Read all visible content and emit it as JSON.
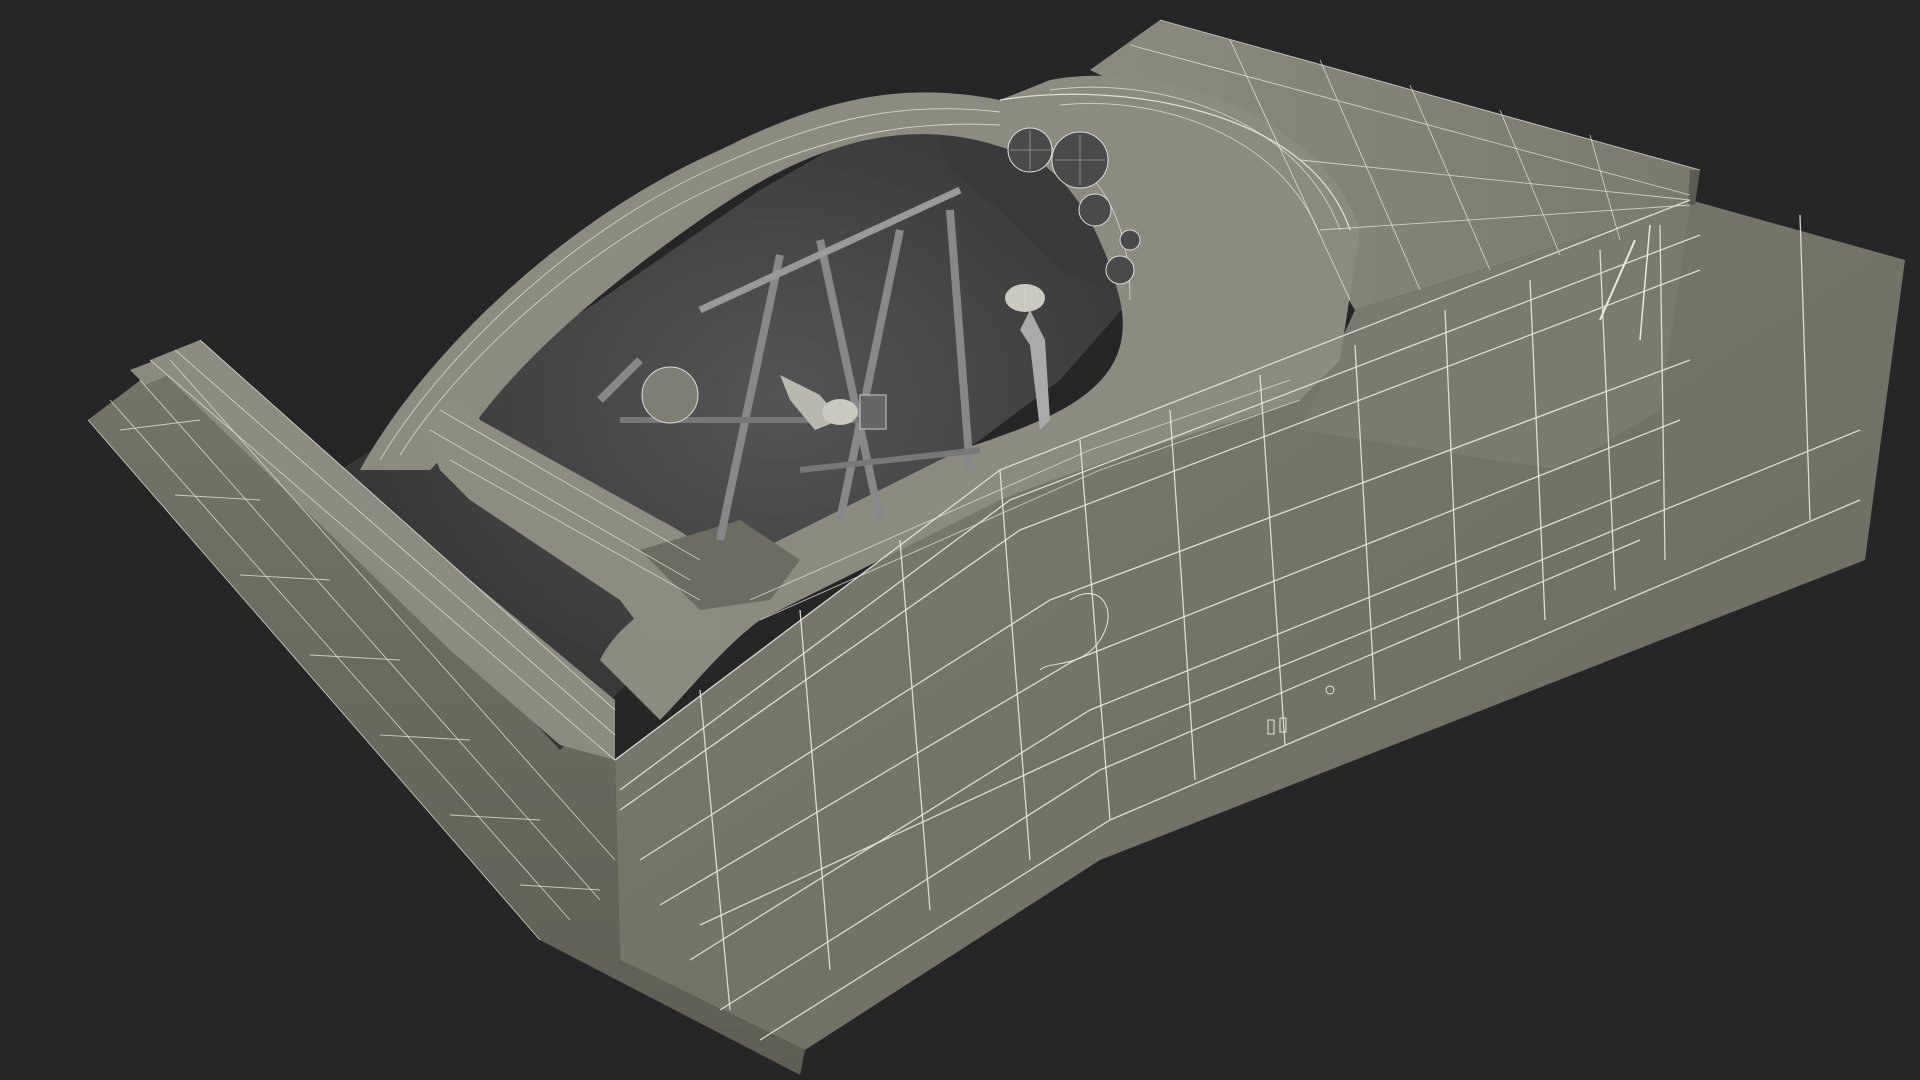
{
  "scene": {
    "background_color": "#262626",
    "model_color": "#767669",
    "model_shadow_color": "#5a5a50",
    "cockpit_interior_color": "#3b3b3b",
    "wireframe_color": "#e8e8dc"
  }
}
